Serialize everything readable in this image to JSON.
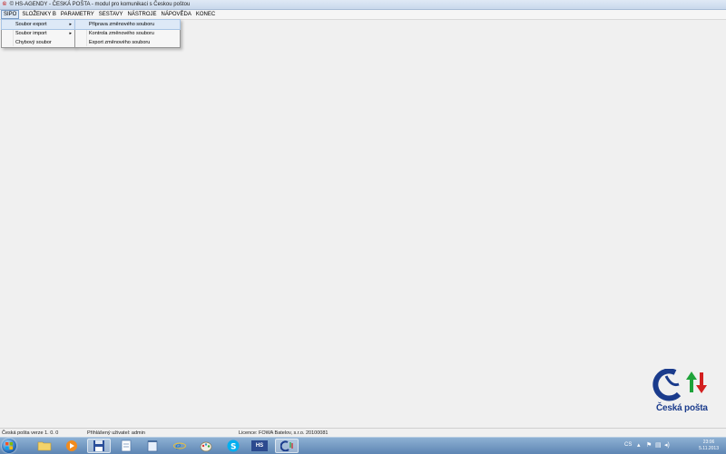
{
  "window": {
    "title": "© HS-AGENDY - ČESKÁ POŠTA - modul pro komunikaci s Českou poštou"
  },
  "menubar": {
    "items": [
      {
        "label": "SIPO"
      },
      {
        "label": "SLOŽENKY B"
      },
      {
        "label": "PARAMETRY"
      },
      {
        "label": "SESTAVY"
      },
      {
        "label": "NÁSTROJE"
      },
      {
        "label": "NÁPOVĚDA"
      },
      {
        "label": "KONEC"
      }
    ]
  },
  "sipo_menu": {
    "items": [
      {
        "label": "Soubor export",
        "has_submenu": true
      },
      {
        "label": "Soubor import",
        "has_submenu": true
      },
      {
        "label": "Chybový soubor",
        "has_submenu": false
      }
    ]
  },
  "export_submenu": {
    "items": [
      {
        "label": "Příprava změnového souboru"
      },
      {
        "label": "Kontrola změnového souboru"
      },
      {
        "label": "Export změnového souboru"
      }
    ]
  },
  "logo": {
    "text": "Česká pošta",
    "colors": {
      "blue": "#1a3b8c",
      "green": "#1fa33a",
      "red": "#d32020"
    }
  },
  "statusbar": {
    "version": "Česká pošta verze 1. 0. 0",
    "user": "Přihlášený uživatel: admin",
    "license": "Licence: FOWA Batelov, s.r.o. 20100081"
  },
  "taskbar": {
    "apps": [
      {
        "icon": "folder-icon"
      },
      {
        "icon": "media-player-icon"
      },
      {
        "icon": "floppy-disk-icon"
      },
      {
        "icon": "document-icon"
      },
      {
        "icon": "notepad-icon"
      },
      {
        "icon": "ie-icon"
      },
      {
        "icon": "paint-icon"
      },
      {
        "icon": "skype-icon"
      },
      {
        "icon": "hs-agendy-icon",
        "label": "HS"
      },
      {
        "icon": "ceska-posta-icon"
      }
    ],
    "tray": {
      "language": "CS",
      "time": "23:06",
      "date": "5.11.2013"
    }
  }
}
